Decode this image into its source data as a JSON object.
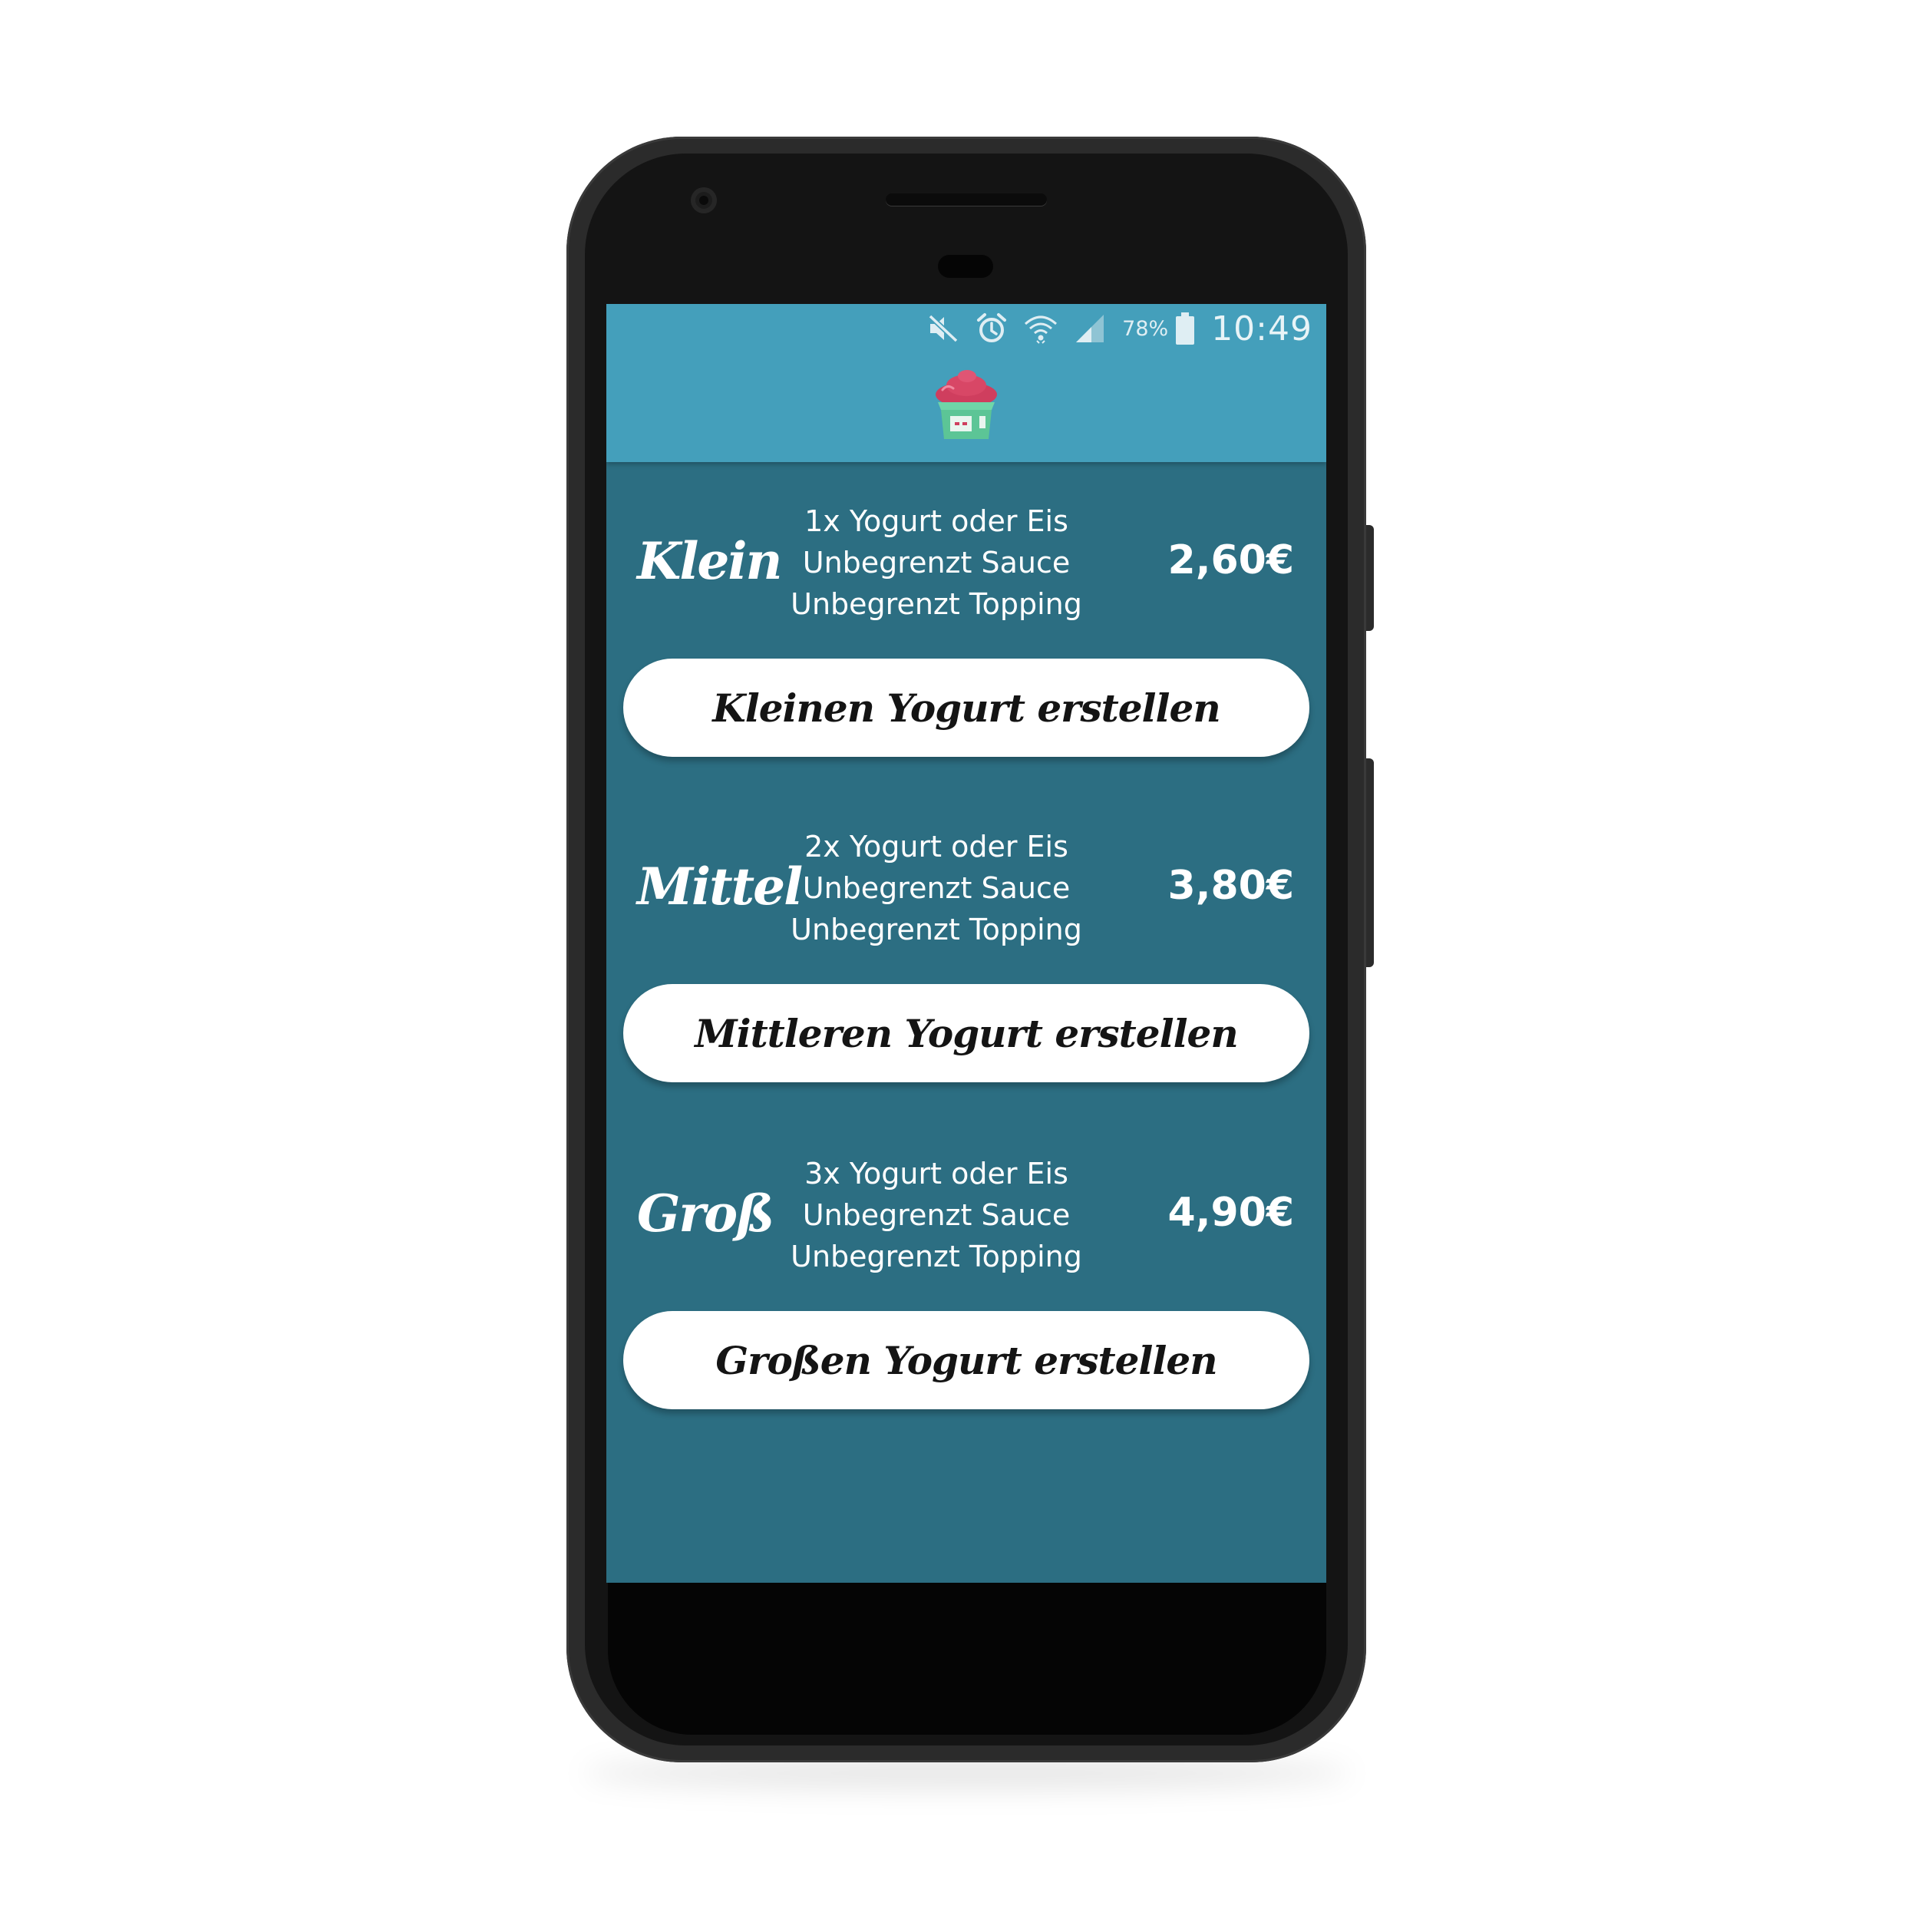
{
  "status_bar": {
    "icons": [
      "mute-icon",
      "alarm-icon",
      "wifi-icon",
      "signal-icon",
      "battery-icon"
    ],
    "battery_percent": "78%",
    "time": "10:49"
  },
  "app": {
    "logo_icon": "frozen-yogurt-cup-icon",
    "colors": {
      "header": "#449fbb",
      "background": "#2c6e82",
      "button": "#ffffff",
      "button_text": "#141414"
    }
  },
  "sizes": [
    {
      "name": "Klein",
      "features": [
        "1x Yogurt oder Eis",
        "Unbegrenzt Sauce",
        "Unbegrenzt Topping"
      ],
      "price": "2,60€",
      "button_label": "Kleinen Yogurt erstellen"
    },
    {
      "name": "Mittel",
      "features": [
        "2x Yogurt oder Eis",
        "Unbegrenzt Sauce",
        "Unbegrenzt Topping"
      ],
      "price": "3,80€",
      "button_label": "Mittleren Yogurt erstellen"
    },
    {
      "name": "Groß",
      "features": [
        "3x Yogurt oder Eis",
        "Unbegrenzt Sauce",
        "Unbegrenzt Topping"
      ],
      "price": "4,90€",
      "button_label": "Großen Yogurt erstellen"
    }
  ]
}
